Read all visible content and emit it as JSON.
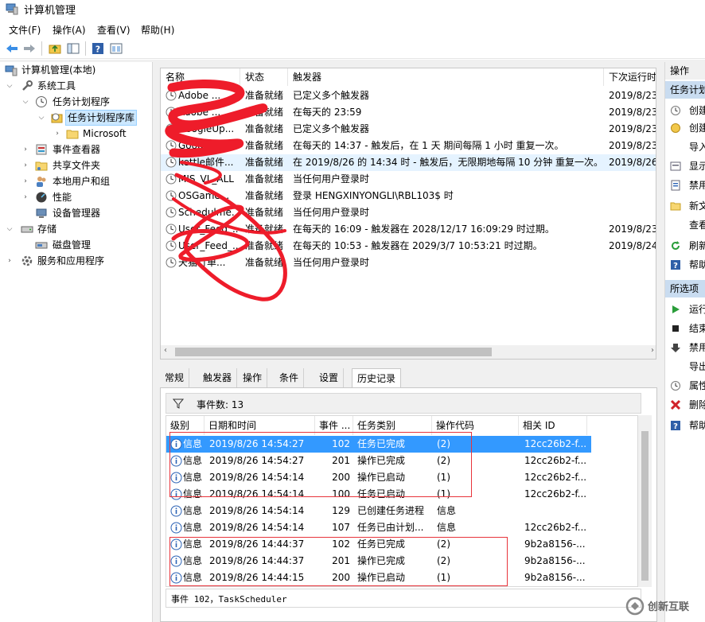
{
  "window": {
    "title": "计算机管理"
  },
  "menu": [
    "文件(F)",
    "操作(A)",
    "查看(V)",
    "帮助(H)"
  ],
  "toolbar_icons": [
    "back-arrow-icon",
    "forward-arrow-icon",
    "up-folder-icon",
    "show-hide-tree-icon",
    "help-icon",
    "console-icon"
  ],
  "tree": {
    "root": "计算机管理(本地)",
    "system_tools": "系统工具",
    "task_scheduler": "任务计划程序",
    "task_library": "任务计划程序库",
    "microsoft": "Microsoft",
    "event_viewer": "事件查看器",
    "shared_folders": "共享文件夹",
    "local_users": "本地用户和组",
    "performance": "性能",
    "device_manager": "设备管理器",
    "storage": "存储",
    "disk_management": "磁盘管理",
    "services_apps": "服务和应用程序"
  },
  "task_list": {
    "columns": [
      "名称",
      "状态",
      "触发器",
      "下次运行时"
    ],
    "rows": [
      {
        "name": "Adobe ...",
        "status": "准备就绪",
        "trigger": "已定义多个触发器",
        "next": "2019/8/23"
      },
      {
        "name": "Adobe ...",
        "status": "准备就绪",
        "trigger": "在每天的 23:59",
        "next": "2019/8/23"
      },
      {
        "name": "GoogleUp...",
        "status": "准备就绪",
        "trigger": "已定义多个触发器",
        "next": "2019/8/23"
      },
      {
        "name": "GoogleUp...",
        "status": "准备就绪",
        "trigger": "在每天的 14:37 - 触发后，在 1 天 期间每隔 1 小时 重复一次。",
        "next": "2019/8/23"
      },
      {
        "name": "kettle邮件...",
        "status": "准备就绪",
        "trigger": "在 2019/8/26 的 14:34 时 - 触发后，无限期地每隔 10 分钟 重复一次。",
        "next": "2019/8/26"
      },
      {
        "name": "MIS_VL_ALL",
        "status": "准备就绪",
        "trigger": "当任何用户登录时",
        "next": ""
      },
      {
        "name": "OSGame...",
        "status": "准备就绪",
        "trigger": "登录 HENGXINYONGLI\\RBL103$ 时",
        "next": ""
      },
      {
        "name": "Schedulme...",
        "status": "准备就绪",
        "trigger": "当任何用户登录时",
        "next": ""
      },
      {
        "name": "User_Feed_...",
        "status": "准备就绪",
        "trigger": "在每天的 16:09 - 触发器在 2028/12/17 16:09:29 时过期。",
        "next": "2019/8/23"
      },
      {
        "name": "User_Feed_...",
        "status": "准备就绪",
        "trigger": "在每天的 10:53 - 触发器在 2029/3/7 10:53:21 时过期。",
        "next": "2019/8/24"
      },
      {
        "name": "天猫订单...",
        "status": "准备就绪",
        "trigger": "当任何用户登录时",
        "next": ""
      }
    ]
  },
  "tabs": [
    "常规",
    "触发器",
    "操作",
    "条件",
    "设置",
    "历史记录"
  ],
  "active_tab": "历史记录",
  "history": {
    "event_count": "事件数: 13",
    "columns": [
      "级别",
      "日期和时间",
      "事件 ...",
      "任务类别",
      "操作代码",
      "相关 ID"
    ],
    "rows": [
      {
        "level": "信息",
        "time": "2019/8/26 14:54:27",
        "id": "102",
        "category": "任务已完成",
        "op": "(2)",
        "rel": "12cc26b2-f..."
      },
      {
        "level": "信息",
        "time": "2019/8/26 14:54:27",
        "id": "201",
        "category": "操作已完成",
        "op": "(2)",
        "rel": "12cc26b2-f..."
      },
      {
        "level": "信息",
        "time": "2019/8/26 14:54:14",
        "id": "200",
        "category": "操作已启动",
        "op": "(1)",
        "rel": "12cc26b2-f..."
      },
      {
        "level": "信息",
        "time": "2019/8/26 14:54:14",
        "id": "100",
        "category": "任务已启动",
        "op": "(1)",
        "rel": "12cc26b2-f..."
      },
      {
        "level": "信息",
        "time": "2019/8/26 14:54:14",
        "id": "129",
        "category": "已创建任务进程",
        "op": "信息",
        "rel": ""
      },
      {
        "level": "信息",
        "time": "2019/8/26 14:54:14",
        "id": "107",
        "category": "任务已由计划...",
        "op": "信息",
        "rel": "12cc26b2-f..."
      },
      {
        "level": "信息",
        "time": "2019/8/26 14:44:37",
        "id": "102",
        "category": "任务已完成",
        "op": "(2)",
        "rel": "9b2a8156-..."
      },
      {
        "level": "信息",
        "time": "2019/8/26 14:44:37",
        "id": "201",
        "category": "操作已完成",
        "op": "(2)",
        "rel": "9b2a8156-..."
      },
      {
        "level": "信息",
        "time": "2019/8/26 14:44:15",
        "id": "200",
        "category": "操作已启动",
        "op": "(1)",
        "rel": "9b2a8156-..."
      }
    ],
    "event_detail": "事件 102，TaskScheduler"
  },
  "actions": {
    "header": "操作",
    "sub1": "任务计划程序库",
    "items1": [
      "创建基本任务...",
      "创建任务...",
      "导入任务...",
      "显示所有正在运行的任务",
      "禁用所有任务历史记录",
      "新文件夹...",
      "查看",
      "刷新",
      "帮助"
    ],
    "sub2": "所选项",
    "items2": [
      "运行",
      "结束",
      "禁用",
      "导出...",
      "属性",
      "删除",
      "帮助"
    ]
  },
  "watermark": "创新互联",
  "colors": {
    "selection": "#3399ff",
    "annotation_red": "#e8343b",
    "scribble_red": "#ee1c2a"
  }
}
